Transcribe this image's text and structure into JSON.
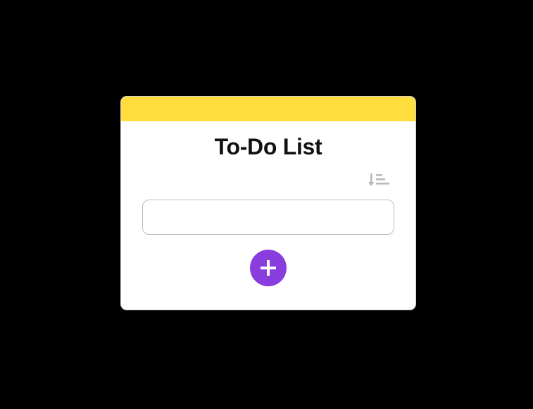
{
  "app": {
    "title": "To-Do List"
  },
  "toolbar": {
    "sort_icon": "sort-descending-lines-icon"
  },
  "form": {
    "input_value": "",
    "input_placeholder": ""
  },
  "actions": {
    "add_icon": "plus-icon"
  },
  "colors": {
    "background": "#000000",
    "header_accent": "#ffdd3c",
    "add_button": "#8a3ddf",
    "sort_icon": "#b9b9b9"
  }
}
